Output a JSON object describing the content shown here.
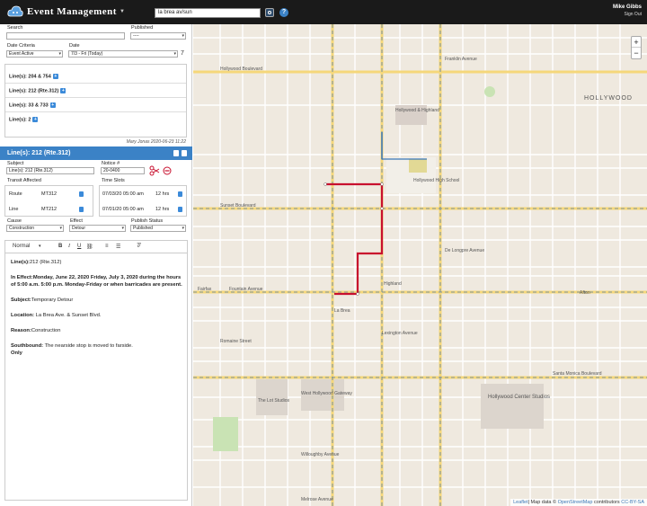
{
  "header": {
    "title": "Event Management",
    "search_value": "la brea av/sun",
    "user_name": "Mike Gibbs",
    "sign_out": "Sign Out"
  },
  "filters": {
    "search_label": "Search",
    "search_value": "",
    "published_label": "Published",
    "published_value": "----",
    "date_criteria_label": "Date Criteria",
    "date_criteria_value": "Event Active",
    "date_label": "Date",
    "date_value": "7/3 - Fri (Today)",
    "count": "7"
  },
  "lines": [
    {
      "label": "Line(s): 204 & 754"
    },
    {
      "label": "Line(s): 212 (Rte.312)"
    },
    {
      "label": "Line(s): 33 & 733"
    },
    {
      "label": "Line(s): 2"
    }
  ],
  "meta": "Mary Jonas 2020-06-23 11:22",
  "detail": {
    "title": "Line(s): 212 (Rte.312)",
    "subject_label": "Subject",
    "subject_value": "Line(s): 212 (Rte.312)",
    "notice_label": "Notice #",
    "notice_value": "20-0400",
    "transit_label": "Transit Affected",
    "timeslots_label": "Time Slots",
    "transit": [
      {
        "type": "Route",
        "id": "MT312"
      },
      {
        "type": "Line",
        "id": "MT212"
      }
    ],
    "timeslots": [
      {
        "date": "07/03/20 05:00 am",
        "dur": "12 hrs"
      },
      {
        "date": "07/01/20 05:00 am",
        "dur": "12 hrs"
      }
    ],
    "cause_label": "Cause",
    "cause_value": "Construction",
    "effect_label": "Effect",
    "effect_value": "Detour",
    "publish_label": "Publish Status",
    "publish_value": "Published"
  },
  "editor": {
    "format": "Normal",
    "p1_bold": "Line(s):",
    "p1_text": "212 (Rte.312)",
    "p2_bold": "In Effect:",
    "p2_text": "Monday, June 22, 2020  Friday, July 3, 2020 during the hours of 5:00 a.m.  5:00 p.m. Monday-Friday or when barricades are present.",
    "p3_bold": "Subject:",
    "p3_text": "Temporary Detour",
    "p4_bold": "Location:",
    "p4_text": " La Brea Ave. & Sunset Blvd.",
    "p5_bold": "Reason:",
    "p5_text": "Construction",
    "p6_bold": "Southbound:",
    "p6_text": " The nearside stop is moved to farside.",
    "p7_bold": "Only"
  },
  "map": {
    "labels": [
      {
        "t": "HOLLYWOOD"
      },
      {
        "t": "Hollywood & Highland"
      },
      {
        "t": "Hollywood High School"
      },
      {
        "t": "The Lot Studios"
      },
      {
        "t": "West Hollywood Gateway"
      },
      {
        "t": "Hollywood Center Studios"
      },
      {
        "t": "Sunset Boulevard"
      },
      {
        "t": "Hollywood Boulevard"
      },
      {
        "t": "Santa Monica Boulevard"
      },
      {
        "t": "Fountain Avenue"
      },
      {
        "t": "Franklin Avenue"
      },
      {
        "t": "Romaine Street"
      },
      {
        "t": "Willoughby Avenue"
      },
      {
        "t": "Melrose Avenue"
      },
      {
        "t": "De Longpre Avenue"
      },
      {
        "t": "Lexington Avenue"
      },
      {
        "t": "Fairfax"
      },
      {
        "t": "La Brea"
      },
      {
        "t": "Highland"
      },
      {
        "t": "Afton"
      }
    ],
    "zoom_in": "+",
    "zoom_out": "−",
    "attribution_leaflet": "Leaflet",
    "attribution_text": "| Map data © ",
    "attribution_osm": "OpenStreetMap",
    "attribution_mid": " contributors ",
    "attribution_cc": "CC-BY-SA"
  },
  "colors": {
    "accent": "#3b82c6",
    "detour": "#c8102e",
    "major_road": "#f5d77a"
  }
}
